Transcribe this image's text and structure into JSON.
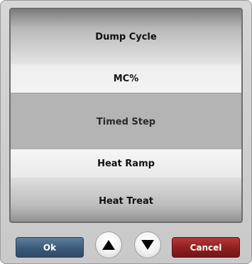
{
  "list": {
    "items": [
      {
        "label": "Dump Cycle",
        "selected": false
      },
      {
        "label": "MC%",
        "selected": false
      },
      {
        "label": "Timed Step",
        "selected": true
      },
      {
        "label": "Heat Ramp",
        "selected": false
      },
      {
        "label": "Heat Treat",
        "selected": false
      }
    ]
  },
  "buttons": {
    "ok_label": "Ok",
    "cancel_label": "Cancel",
    "up_icon": "triangle-up-icon",
    "down_icon": "triangle-down-icon"
  },
  "colors": {
    "ok": "#3b5a7a",
    "cancel": "#8e1f1f",
    "selected_row": "#b4b4b4"
  }
}
